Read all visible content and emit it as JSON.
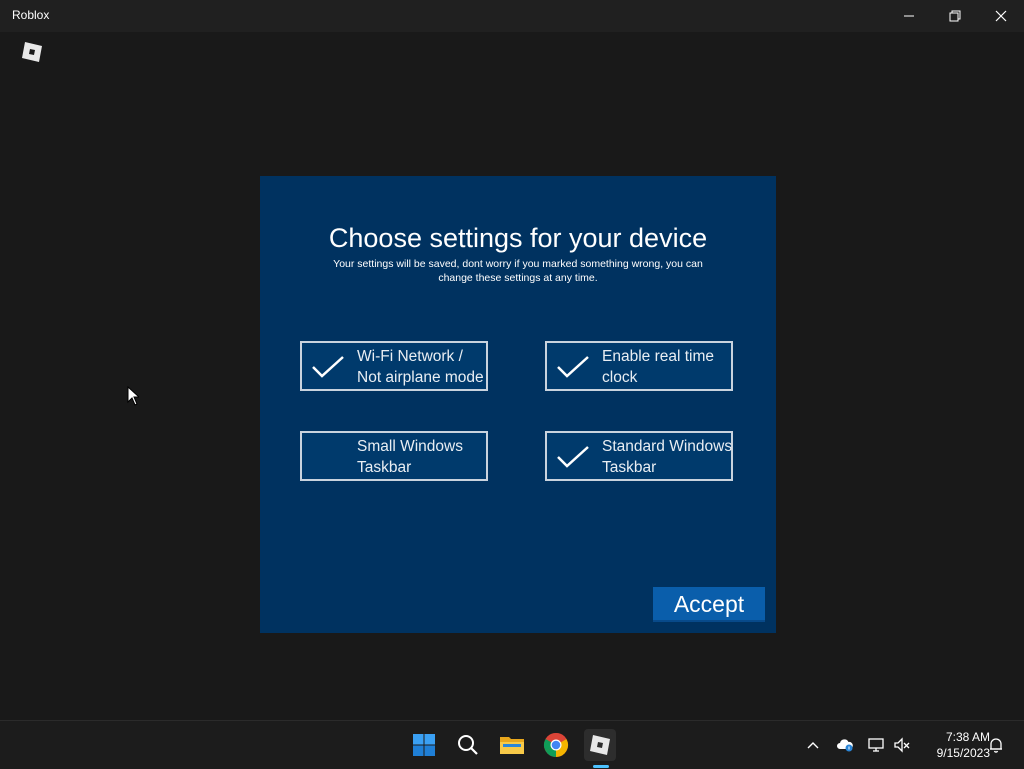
{
  "window": {
    "title": "Roblox"
  },
  "dialog": {
    "title": "Choose settings for your device",
    "subtitle": "Your settings will be saved, dont worry if you marked something wrong, you can change these settings at any time.",
    "options": [
      {
        "label": "Wi-Fi Network / Not airplane mode",
        "checked": true
      },
      {
        "label": "Enable real time clock",
        "checked": true
      },
      {
        "label": "Small Windows Taskbar",
        "checked": false
      },
      {
        "label": "Standard Windows Taskbar",
        "checked": true
      }
    ],
    "accept_label": "Accept"
  },
  "taskbar": {
    "apps": [
      "start-icon",
      "search-icon",
      "file-explorer-icon",
      "chrome-icon",
      "roblox-icon"
    ],
    "time": "7:38 AM",
    "date": "9/15/2023"
  },
  "colors": {
    "dialog_bg": "#003260",
    "accept_bg": "#0a5eab",
    "desktop_bg": "#191919"
  }
}
